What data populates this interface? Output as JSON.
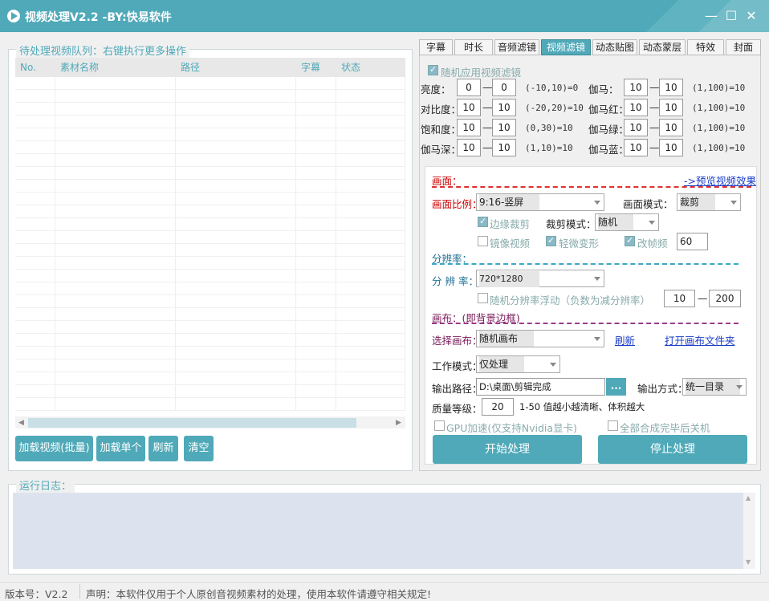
{
  "window": {
    "title": "视频处理V2.2 -BY:快易软件",
    "min": "—",
    "max": "☐",
    "close": "✕"
  },
  "queue": {
    "label": "待处理视频队列：右键执行更多操作",
    "columns": [
      "No.",
      "素材名称",
      "路径",
      "字幕",
      "状态"
    ],
    "buttons": {
      "batch": "加载视频(批量)",
      "single": "加载单个",
      "refresh": "刷新",
      "clear": "清空"
    }
  },
  "tabs": [
    "字幕",
    "时长",
    "音频滤镜",
    "视频滤镜",
    "动态贴图",
    "动态蒙层",
    "特效",
    "封面"
  ],
  "active_tab": "视频滤镜",
  "filter": {
    "random_apply": "随机应用视频滤镜",
    "brightness": {
      "label": "亮度：",
      "min": "0",
      "max": "0",
      "hint": "(-10,10)=0"
    },
    "contrast": {
      "label": "对比度：",
      "min": "10",
      "max": "10",
      "hint": "(-20,20)=10"
    },
    "saturation": {
      "label": "饱和度：",
      "min": "10",
      "max": "10",
      "hint": "(0,30)=10"
    },
    "gamma_deep": {
      "label": "伽马深：",
      "min": "10",
      "max": "10",
      "hint": "(1,10)=10"
    },
    "gamma": {
      "label": "伽马：",
      "min": "10",
      "max": "10",
      "hint": "(1,100)=10"
    },
    "gamma_red": {
      "label": "伽马红：",
      "min": "10",
      "max": "10",
      "hint": "(1,100)=10"
    },
    "gamma_green": {
      "label": "伽马绿：",
      "min": "10",
      "max": "10",
      "hint": "(1,100)=10"
    },
    "gamma_blue": {
      "label": "伽马蓝：",
      "min": "10",
      "max": "10",
      "hint": "(1,100)=10"
    },
    "dash": "—"
  },
  "picture": {
    "section": "画面：",
    "preview_link": "->预览视频效果",
    "ratio_label": "画面比例：",
    "ratio_value": "9:16-竖屏",
    "mode_label": "画面模式：",
    "mode_value": "裁剪",
    "edge_crop": "边缘裁剪",
    "crop_mode_label": "裁剪模式：",
    "crop_mode_value": "随机",
    "mirror": "镜像视频",
    "slight_deform": "轻微变形",
    "change_fps": "改帧频",
    "fps_value": "60"
  },
  "resolution": {
    "section": "分辨率：",
    "label": "分 辨 率：",
    "value": "720*1280",
    "random_float": "随机分辨率浮动（负数为减分辨率）",
    "float_min": "10",
    "float_max": "200"
  },
  "canvas": {
    "section": "画布：(即背景边框)",
    "select_label": "选择画布：",
    "select_value": "随机画布",
    "refresh_link": "刷新",
    "open_folder_link": "打开画布文件夹"
  },
  "work": {
    "mode_label": "工作模式：",
    "mode_value": "仅处理",
    "out_path_label": "输出路径：",
    "out_path_value": "D:\\桌面\\剪辑完成",
    "browse": "...",
    "out_method_label": "输出方式：",
    "out_method_value": "统一目录",
    "quality_label": "质量等级：",
    "quality_value": "20",
    "quality_hint": "1-50 值越小越清晰、体积越大",
    "gpu": "GPU加速(仅支持Nvidia显卡)",
    "shutdown": "全部合成完毕后关机",
    "start": "开始处理",
    "stop": "停止处理"
  },
  "log": {
    "label": "运行日志："
  },
  "status": {
    "version": "版本号：V2.2",
    "notice": "声明：本软件仅用于个人原创音视频素材的处理，使用本软件请遵守相关规定!"
  },
  "colors": {
    "accent": "#4fa9b8",
    "red": "#e03030",
    "link": "#1a3cc8"
  }
}
